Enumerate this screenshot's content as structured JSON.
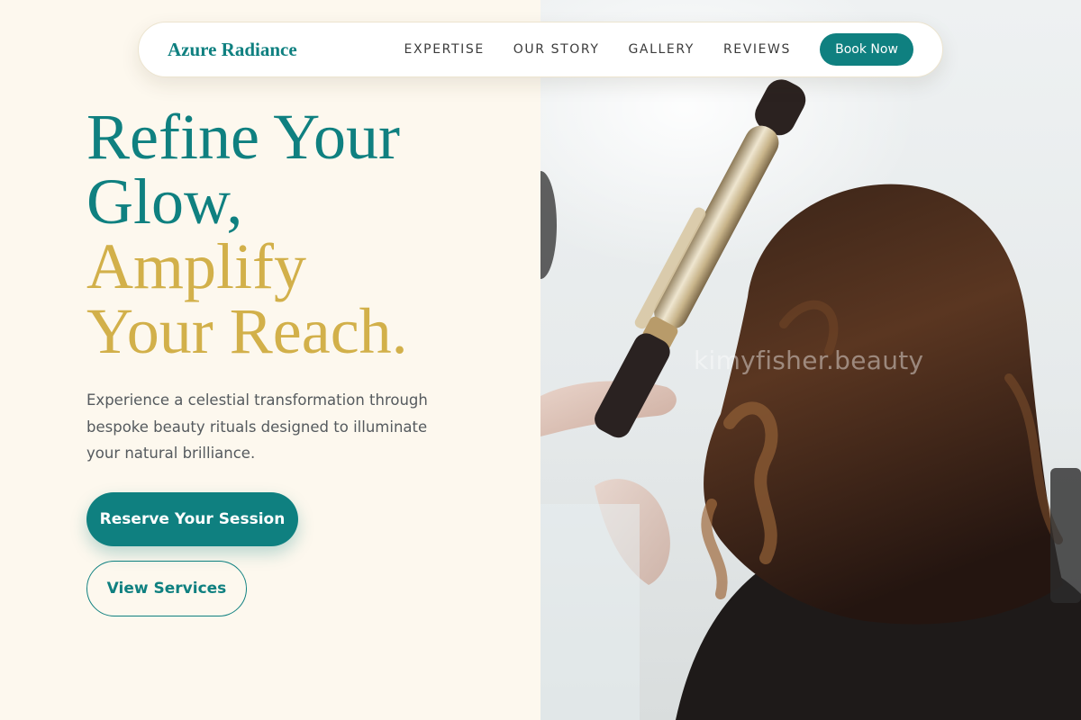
{
  "brand": {
    "name": "Azure Radiance"
  },
  "nav": {
    "links": [
      "EXPERTISE",
      "OUR STORY",
      "GALLERY",
      "REVIEWS"
    ],
    "cta": "Book Now"
  },
  "hero": {
    "headline": [
      "Refine Your",
      "Glow,",
      "Amplify",
      "Your Reach."
    ],
    "description": "Experience a celestial transformation through bespoke beauty rituals designed to illuminate your natural brilliance.",
    "primary_button": "Reserve Your Session",
    "secondary_button": "View Services"
  },
  "photo": {
    "watermark": "kimyfisher.beauty"
  },
  "colors": {
    "accent": "#0f8080",
    "gold": "#d2b04a",
    "background": "#fdf8ee"
  },
  "icons": []
}
